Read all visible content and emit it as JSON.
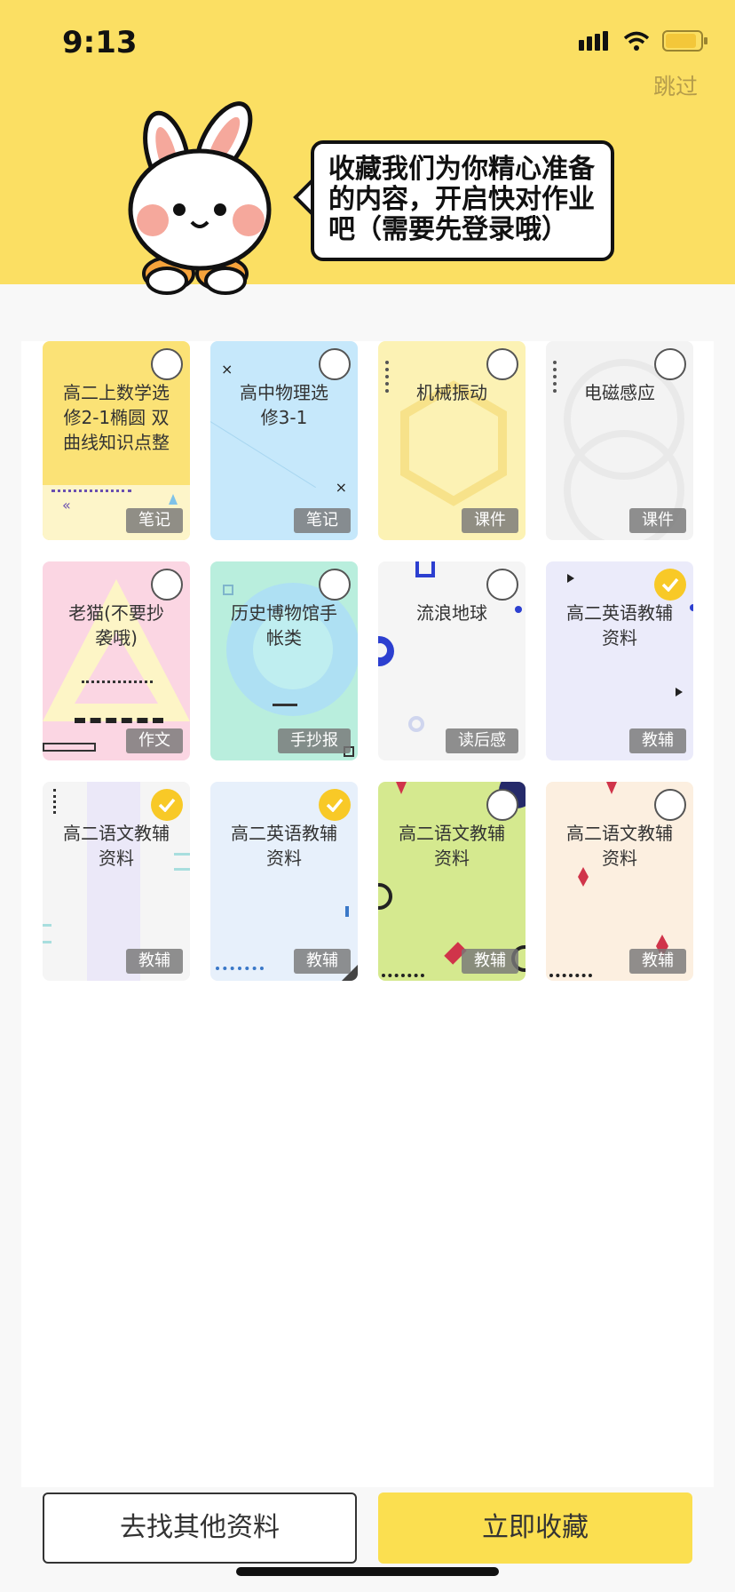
{
  "status_bar": {
    "time": "9:13"
  },
  "header": {
    "skip_label": "跳过",
    "speech": "收藏我们为你精心准备的内容，开启快对作业吧（需要先登录哦）"
  },
  "cards": [
    {
      "title": "高二上数学选\n修2-1椭圆 双\n曲线知识点整",
      "tag": "笔记",
      "checked": false
    },
    {
      "title": "高中物理选\n修3-1",
      "tag": "笔记",
      "checked": false
    },
    {
      "title": "机械振动",
      "tag": "课件",
      "checked": false
    },
    {
      "title": "电磁感应",
      "tag": "课件",
      "checked": false
    },
    {
      "title": "老猫(不要抄\n袭哦)",
      "tag": "作文",
      "checked": false
    },
    {
      "title": "历史博物馆手\n帐类",
      "tag": "手抄报",
      "checked": false
    },
    {
      "title": "流浪地球",
      "tag": "读后感",
      "checked": false
    },
    {
      "title": "高二英语教辅\n资料",
      "tag": "教辅",
      "checked": true
    },
    {
      "title": "高二语文教辅\n资料",
      "tag": "教辅",
      "checked": true
    },
    {
      "title": "高二英语教辅\n资料",
      "tag": "教辅",
      "checked": true
    },
    {
      "title": "高二语文教辅\n资料",
      "tag": "教辅",
      "checked": false
    },
    {
      "title": "高二语文教辅\n资料",
      "tag": "教辅",
      "checked": false
    }
  ],
  "buttons": {
    "find_other": "去找其他资料",
    "collect_now": "立即收藏"
  },
  "colors": {
    "brand_yellow": "#fbdf63",
    "check_yellow": "#f8c927"
  }
}
